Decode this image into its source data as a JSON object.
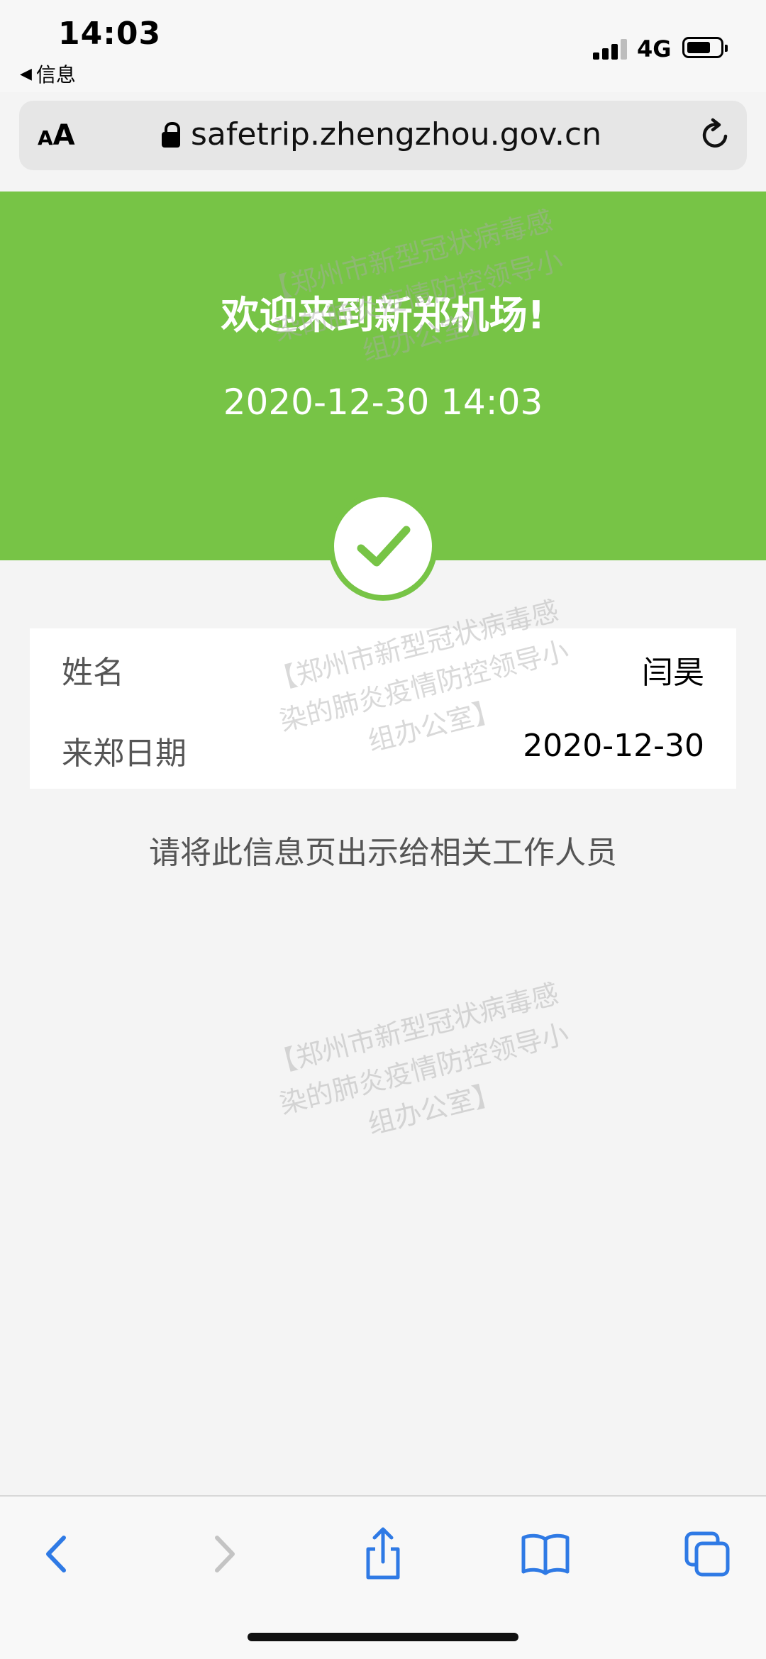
{
  "status_bar": {
    "time": "14:03",
    "back_app": "信息",
    "network": "4G"
  },
  "address_bar": {
    "text_size_small": "A",
    "text_size_large": "A",
    "url": "safetrip.zhengzhou.gov.cn"
  },
  "hero": {
    "title": "欢迎来到新郑机场!",
    "datetime": "2020-12-30 14:03",
    "color": "#77c446"
  },
  "info": {
    "rows": [
      {
        "label": "姓名",
        "value": "闫昊"
      },
      {
        "label": "来郑日期",
        "value": "2020-12-30"
      }
    ]
  },
  "hint": "请将此信息页出示给相关工作人员",
  "watermark": "【郑州市新型冠状病毒感染的肺炎疫情防控领导小组办公室】",
  "toolbar": {
    "accent": "#2f7ae5",
    "icons": [
      "back-icon",
      "forward-icon",
      "share-icon",
      "bookmarks-icon",
      "tabs-icon"
    ]
  }
}
